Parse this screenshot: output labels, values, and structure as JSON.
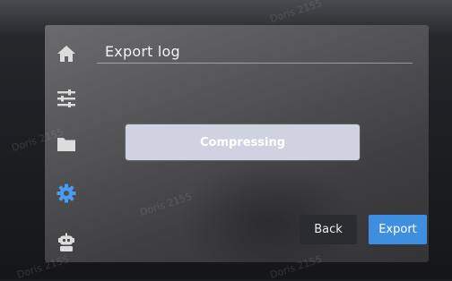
{
  "screen": {
    "title": "Export log",
    "progress_text": "Compressing"
  },
  "sidebar": {
    "items": [
      {
        "name": "home",
        "icon": "home-icon"
      },
      {
        "name": "settings",
        "icon": "sliders-icon"
      },
      {
        "name": "files",
        "icon": "folder-icon"
      },
      {
        "name": "system",
        "icon": "gear-icon",
        "active": true
      },
      {
        "name": "robot",
        "icon": "robot-icon"
      }
    ]
  },
  "buttons": {
    "back_label": "Back",
    "export_label": "Export"
  },
  "watermark": "Doris 2155",
  "colors": {
    "accent": "#3f8ee0",
    "icon": "#dcdcdc",
    "active_icon": "#4a9cf0",
    "progress_bg": "#cfd2e0"
  }
}
